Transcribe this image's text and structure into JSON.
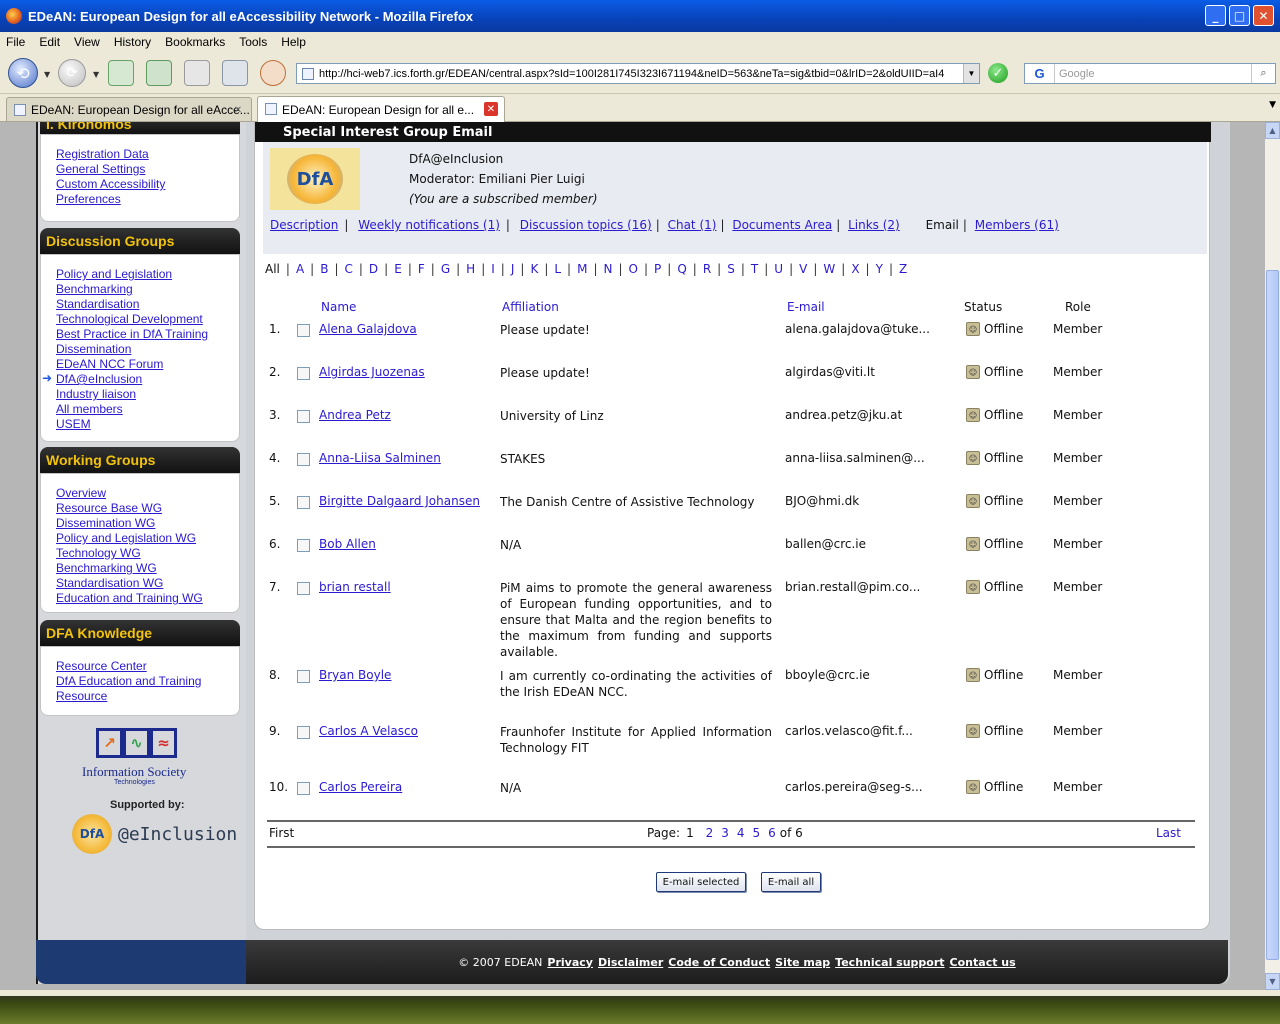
{
  "window": {
    "title": "EDeAN: European Design for all eAccessibility Network - Mozilla Firefox",
    "min": "_",
    "max": "□",
    "close": "✕"
  },
  "menu": [
    "File",
    "Edit",
    "View",
    "History",
    "Bookmarks",
    "Tools",
    "Help"
  ],
  "nav": {
    "url": "http://hci-web7.ics.forth.gr/EDEAN/central.aspx?sId=100I281I745I323I671194&neID=563&neTa=sig&tbid=0&lrID=2&oldUIID=aI4",
    "search_placeholder": "Google",
    "search_engine": "G"
  },
  "tabs": [
    {
      "label": "EDeAN: European Design for all eAcce..."
    },
    {
      "label": "EDeAN: European Design for all e..."
    }
  ],
  "sidebar": {
    "user_name": "I. Kironomos",
    "user_links": [
      "Registration Data",
      "General Settings",
      "Custom Accessibility",
      "Preferences"
    ],
    "discussion_title": "Discussion Groups",
    "discussion_links": [
      "Policy and Legislation",
      "Benchmarking",
      "Standardisation",
      "Technological Development",
      "Best Practice in DfA Training",
      "Dissemination",
      "EDeAN NCC Forum",
      "DfA@eInclusion",
      "Industry liaison",
      "All members",
      "USEM"
    ],
    "working_title": "Working Groups",
    "working_links": [
      "Overview",
      "Resource Base WG",
      "Dissemination WG",
      "Policy and Legislation WG",
      "Technology WG",
      "Benchmarking WG",
      "Standardisation WG",
      "Education and Training WG"
    ],
    "knowledge_title": "DFA Knowledge",
    "knowledge_links": [
      "Resource Center",
      "DfA Education and Training",
      "Resource"
    ],
    "logo_text": "Information Society",
    "logo_sub": "Technologies",
    "supported_by": "Supported by:",
    "einclusion_logo": "DfA",
    "einclusion": "@eInclusion"
  },
  "sig": {
    "header": "Special Interest Group Email",
    "logo": "DfA",
    "group_name": "DfA@eInclusion",
    "moderator": "Moderator: Emiliani Pier Luigi",
    "subscription": "(You are a subscribed member)",
    "subnav": {
      "description": "Description",
      "weekly": "Weekly notifications (1)",
      "topics": "Discussion topics (16)",
      "chat": "Chat (1)",
      "docs": "Documents Area",
      "links": "Links (2)",
      "email": "Email",
      "members": "Members (61)"
    }
  },
  "alphabet": {
    "all": "All",
    "letters": [
      "A",
      "B",
      "C",
      "D",
      "E",
      "F",
      "G",
      "H",
      "I",
      "J",
      "K",
      "L",
      "M",
      "N",
      "O",
      "P",
      "Q",
      "R",
      "S",
      "T",
      "U",
      "V",
      "W",
      "X",
      "Y",
      "Z"
    ]
  },
  "table": {
    "headers": {
      "name": "Name",
      "affiliation": "Affiliation",
      "email": "E-mail",
      "status": "Status",
      "role": "Role"
    },
    "rows": [
      {
        "num": "1.",
        "name": "Alena Galajdova",
        "aff": "Please update!",
        "email": "alena.galajdova@tuke...",
        "status": "Offline",
        "role": "Member"
      },
      {
        "num": "2.",
        "name": "Algirdas Juozenas",
        "aff": "Please update!",
        "email": "algirdas@viti.lt",
        "status": "Offline",
        "role": "Member"
      },
      {
        "num": "3.",
        "name": "Andrea Petz",
        "aff": "University of Linz",
        "email": "andrea.petz@jku.at",
        "status": "Offline",
        "role": "Member"
      },
      {
        "num": "4.",
        "name": "Anna-Liisa Salminen",
        "aff": "STAKES",
        "email": "anna-liisa.salminen@...",
        "status": "Offline",
        "role": "Member"
      },
      {
        "num": "5.",
        "name": "Birgitte Dalgaard Johansen",
        "aff": "The Danish Centre of Assistive Technology",
        "email": "BJO@hmi.dk",
        "status": "Offline",
        "role": "Member"
      },
      {
        "num": "6.",
        "name": "Bob Allen",
        "aff": "N/A",
        "email": "ballen@crc.ie",
        "status": "Offline",
        "role": "Member"
      },
      {
        "num": "7.",
        "name": "brian restall",
        "aff": "PiM aims to promote the general awareness of European funding opportunities, and to ensure that Malta and the region benefits to the maximum from funding and supports available.",
        "email": "brian.restall@pim.co...",
        "status": "Offline",
        "role": "Member"
      },
      {
        "num": "8.",
        "name": "Bryan Boyle",
        "aff": "I am currently co-ordinating the activities of the Irish EDeAN NCC.",
        "email": "bboyle@crc.ie",
        "status": "Offline",
        "role": "Member"
      },
      {
        "num": "9.",
        "name": "Carlos A Velasco",
        "aff": "Fraunhofer Institute for Applied Information Technology FIT",
        "email": "carlos.velasco@fit.f...",
        "status": "Offline",
        "role": "Member"
      },
      {
        "num": "10.",
        "name": "Carlos Pereira",
        "aff": "N/A",
        "email": "carlos.pereira@seg-s...",
        "status": "Offline",
        "role": "Member"
      }
    ]
  },
  "pager": {
    "first": "First",
    "page_label": "Page:",
    "current": "1",
    "pages": [
      "2",
      "3",
      "4",
      "5",
      "6"
    ],
    "of": "of 6",
    "last": "Last"
  },
  "buttons": {
    "email_selected": "E-mail selected",
    "email_all": "E-mail all"
  },
  "footer": {
    "copyright": "© 2007 EDEAN",
    "links": [
      "Privacy",
      "Disclaimer",
      "Code of Conduct",
      "Site map",
      "Technical support",
      "Contact us"
    ]
  }
}
